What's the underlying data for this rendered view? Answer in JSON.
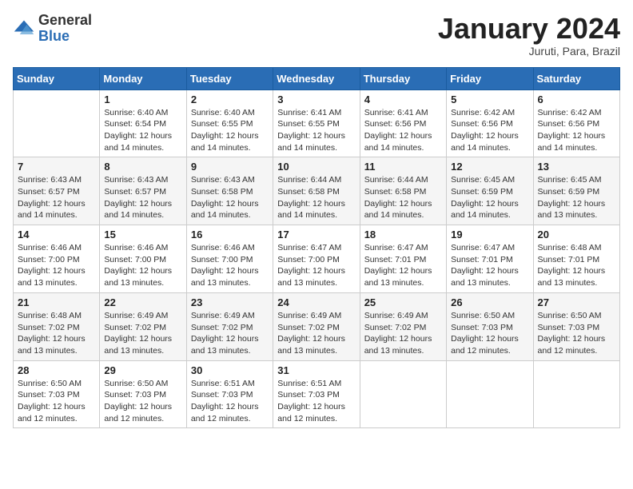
{
  "header": {
    "logo_general": "General",
    "logo_blue": "Blue",
    "month_title": "January 2024",
    "subtitle": "Juruti, Para, Brazil"
  },
  "days_of_week": [
    "Sunday",
    "Monday",
    "Tuesday",
    "Wednesday",
    "Thursday",
    "Friday",
    "Saturday"
  ],
  "weeks": [
    [
      {
        "day": "",
        "info": ""
      },
      {
        "day": "1",
        "info": "Sunrise: 6:40 AM\nSunset: 6:54 PM\nDaylight: 12 hours\nand 14 minutes."
      },
      {
        "day": "2",
        "info": "Sunrise: 6:40 AM\nSunset: 6:55 PM\nDaylight: 12 hours\nand 14 minutes."
      },
      {
        "day": "3",
        "info": "Sunrise: 6:41 AM\nSunset: 6:55 PM\nDaylight: 12 hours\nand 14 minutes."
      },
      {
        "day": "4",
        "info": "Sunrise: 6:41 AM\nSunset: 6:56 PM\nDaylight: 12 hours\nand 14 minutes."
      },
      {
        "day": "5",
        "info": "Sunrise: 6:42 AM\nSunset: 6:56 PM\nDaylight: 12 hours\nand 14 minutes."
      },
      {
        "day": "6",
        "info": "Sunrise: 6:42 AM\nSunset: 6:56 PM\nDaylight: 12 hours\nand 14 minutes."
      }
    ],
    [
      {
        "day": "7",
        "info": "Sunrise: 6:43 AM\nSunset: 6:57 PM\nDaylight: 12 hours\nand 14 minutes."
      },
      {
        "day": "8",
        "info": "Sunrise: 6:43 AM\nSunset: 6:57 PM\nDaylight: 12 hours\nand 14 minutes."
      },
      {
        "day": "9",
        "info": "Sunrise: 6:43 AM\nSunset: 6:58 PM\nDaylight: 12 hours\nand 14 minutes."
      },
      {
        "day": "10",
        "info": "Sunrise: 6:44 AM\nSunset: 6:58 PM\nDaylight: 12 hours\nand 14 minutes."
      },
      {
        "day": "11",
        "info": "Sunrise: 6:44 AM\nSunset: 6:58 PM\nDaylight: 12 hours\nand 14 minutes."
      },
      {
        "day": "12",
        "info": "Sunrise: 6:45 AM\nSunset: 6:59 PM\nDaylight: 12 hours\nand 14 minutes."
      },
      {
        "day": "13",
        "info": "Sunrise: 6:45 AM\nSunset: 6:59 PM\nDaylight: 12 hours\nand 13 minutes."
      }
    ],
    [
      {
        "day": "14",
        "info": "Sunrise: 6:46 AM\nSunset: 7:00 PM\nDaylight: 12 hours\nand 13 minutes."
      },
      {
        "day": "15",
        "info": "Sunrise: 6:46 AM\nSunset: 7:00 PM\nDaylight: 12 hours\nand 13 minutes."
      },
      {
        "day": "16",
        "info": "Sunrise: 6:46 AM\nSunset: 7:00 PM\nDaylight: 12 hours\nand 13 minutes."
      },
      {
        "day": "17",
        "info": "Sunrise: 6:47 AM\nSunset: 7:00 PM\nDaylight: 12 hours\nand 13 minutes."
      },
      {
        "day": "18",
        "info": "Sunrise: 6:47 AM\nSunset: 7:01 PM\nDaylight: 12 hours\nand 13 minutes."
      },
      {
        "day": "19",
        "info": "Sunrise: 6:47 AM\nSunset: 7:01 PM\nDaylight: 12 hours\nand 13 minutes."
      },
      {
        "day": "20",
        "info": "Sunrise: 6:48 AM\nSunset: 7:01 PM\nDaylight: 12 hours\nand 13 minutes."
      }
    ],
    [
      {
        "day": "21",
        "info": "Sunrise: 6:48 AM\nSunset: 7:02 PM\nDaylight: 12 hours\nand 13 minutes."
      },
      {
        "day": "22",
        "info": "Sunrise: 6:49 AM\nSunset: 7:02 PM\nDaylight: 12 hours\nand 13 minutes."
      },
      {
        "day": "23",
        "info": "Sunrise: 6:49 AM\nSunset: 7:02 PM\nDaylight: 12 hours\nand 13 minutes."
      },
      {
        "day": "24",
        "info": "Sunrise: 6:49 AM\nSunset: 7:02 PM\nDaylight: 12 hours\nand 13 minutes."
      },
      {
        "day": "25",
        "info": "Sunrise: 6:49 AM\nSunset: 7:02 PM\nDaylight: 12 hours\nand 13 minutes."
      },
      {
        "day": "26",
        "info": "Sunrise: 6:50 AM\nSunset: 7:03 PM\nDaylight: 12 hours\nand 12 minutes."
      },
      {
        "day": "27",
        "info": "Sunrise: 6:50 AM\nSunset: 7:03 PM\nDaylight: 12 hours\nand 12 minutes."
      }
    ],
    [
      {
        "day": "28",
        "info": "Sunrise: 6:50 AM\nSunset: 7:03 PM\nDaylight: 12 hours\nand 12 minutes."
      },
      {
        "day": "29",
        "info": "Sunrise: 6:50 AM\nSunset: 7:03 PM\nDaylight: 12 hours\nand 12 minutes."
      },
      {
        "day": "30",
        "info": "Sunrise: 6:51 AM\nSunset: 7:03 PM\nDaylight: 12 hours\nand 12 minutes."
      },
      {
        "day": "31",
        "info": "Sunrise: 6:51 AM\nSunset: 7:03 PM\nDaylight: 12 hours\nand 12 minutes."
      },
      {
        "day": "",
        "info": ""
      },
      {
        "day": "",
        "info": ""
      },
      {
        "day": "",
        "info": ""
      }
    ]
  ]
}
